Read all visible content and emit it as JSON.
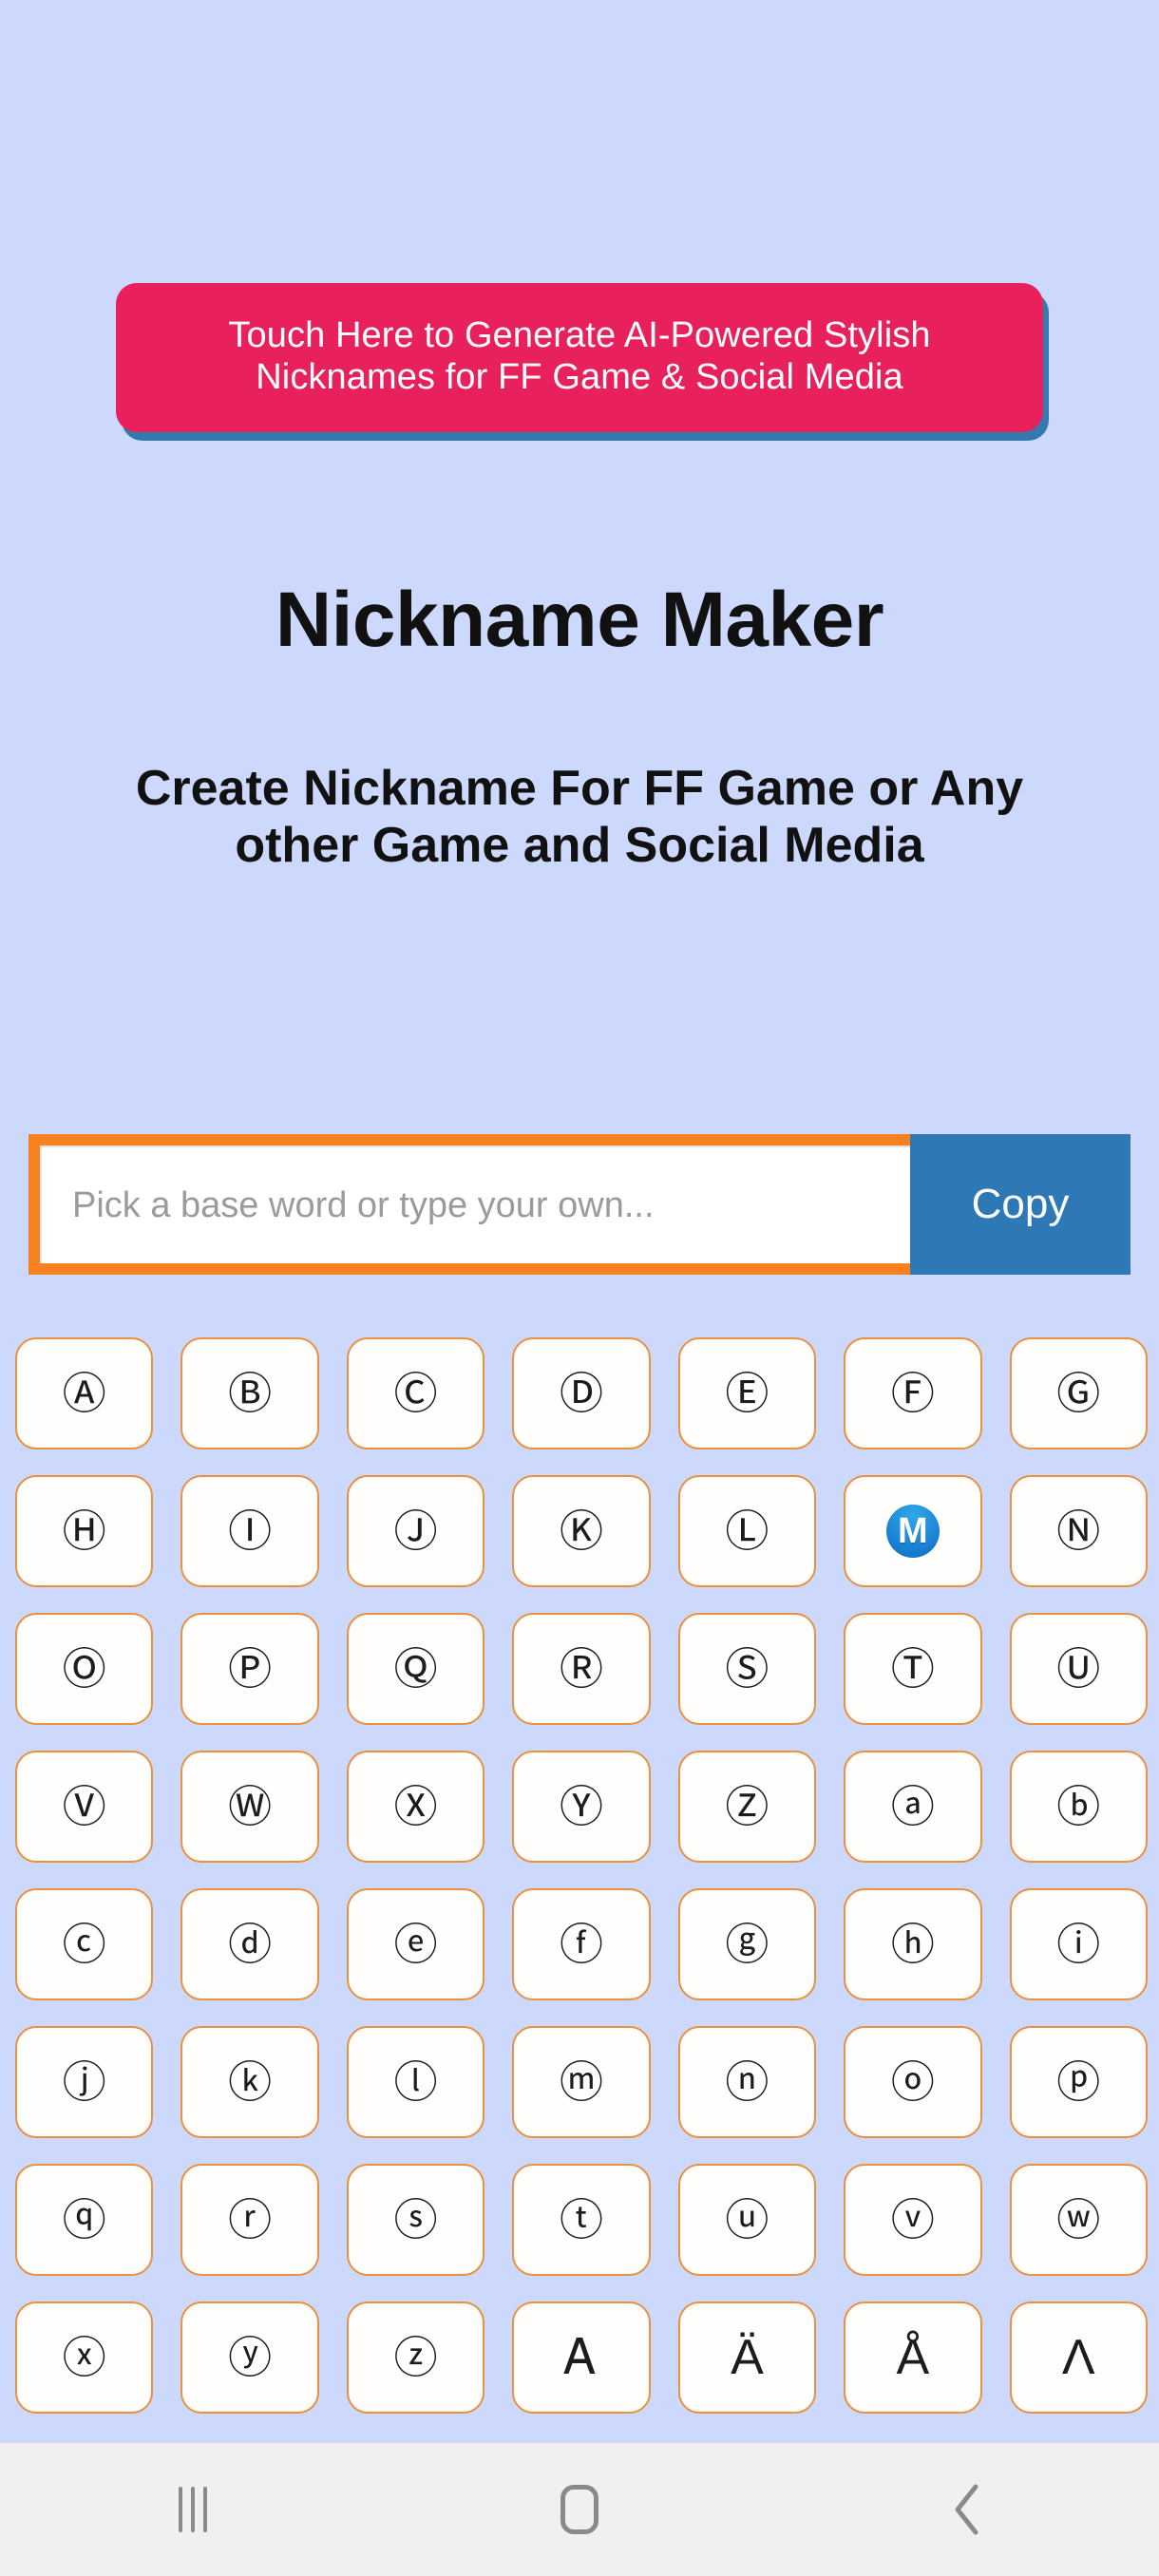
{
  "colors": {
    "background": "#ccd9fc",
    "banner_pink": "#e8215c",
    "banner_shadow_blue": "#3579ae",
    "accent_orange": "#f68121",
    "tile_border_orange": "#e8913f",
    "copy_blue": "#2e79b5",
    "selected_blue": "#1e86d6",
    "navbar_bg": "#f0f0f0"
  },
  "banner": {
    "label": "Touch Here to Generate AI-Powered Stylish Nicknames for FF Game & Social Media"
  },
  "header": {
    "title": "Nickname Maker",
    "subtitle": "Create Nickname For FF Game or Any other Game and Social Media"
  },
  "search": {
    "value": "",
    "placeholder": "Pick a base word or type your own...",
    "copy_label": "Copy"
  },
  "grid": {
    "columns": 7,
    "selected_index": 12,
    "tiles": [
      {
        "char": "Ⓐ",
        "label": "A",
        "style": "circled"
      },
      {
        "char": "Ⓑ",
        "label": "B",
        "style": "circled"
      },
      {
        "char": "Ⓒ",
        "label": "C",
        "style": "circled"
      },
      {
        "char": "Ⓓ",
        "label": "D",
        "style": "circled"
      },
      {
        "char": "Ⓔ",
        "label": "E",
        "style": "circled"
      },
      {
        "char": "Ⓕ",
        "label": "F",
        "style": "circled"
      },
      {
        "char": "Ⓖ",
        "label": "G",
        "style": "circled"
      },
      {
        "char": "Ⓗ",
        "label": "H",
        "style": "circled"
      },
      {
        "char": "Ⓘ",
        "label": "I",
        "style": "circled"
      },
      {
        "char": "Ⓙ",
        "label": "J",
        "style": "circled"
      },
      {
        "char": "Ⓚ",
        "label": "K",
        "style": "circled"
      },
      {
        "char": "Ⓛ",
        "label": "L",
        "style": "circled"
      },
      {
        "char": "M",
        "label": "M",
        "style": "emoji-blue-circle"
      },
      {
        "char": "Ⓝ",
        "label": "N",
        "style": "circled"
      },
      {
        "char": "Ⓞ",
        "label": "O",
        "style": "circled"
      },
      {
        "char": "Ⓟ",
        "label": "P",
        "style": "circled"
      },
      {
        "char": "Ⓠ",
        "label": "Q",
        "style": "circled"
      },
      {
        "char": "Ⓡ",
        "label": "R",
        "style": "circled"
      },
      {
        "char": "Ⓢ",
        "label": "S",
        "style": "circled"
      },
      {
        "char": "Ⓣ",
        "label": "T",
        "style": "circled"
      },
      {
        "char": "Ⓤ",
        "label": "U",
        "style": "circled"
      },
      {
        "char": "Ⓥ",
        "label": "V",
        "style": "circled"
      },
      {
        "char": "Ⓦ",
        "label": "W",
        "style": "circled"
      },
      {
        "char": "Ⓧ",
        "label": "X",
        "style": "circled"
      },
      {
        "char": "Ⓨ",
        "label": "Y",
        "style": "circled"
      },
      {
        "char": "Ⓩ",
        "label": "Z",
        "style": "circled"
      },
      {
        "char": "ⓐ",
        "label": "a",
        "style": "circled"
      },
      {
        "char": "ⓑ",
        "label": "b",
        "style": "circled"
      },
      {
        "char": "ⓒ",
        "label": "c",
        "style": "circled"
      },
      {
        "char": "ⓓ",
        "label": "d",
        "style": "circled"
      },
      {
        "char": "ⓔ",
        "label": "e",
        "style": "circled"
      },
      {
        "char": "ⓕ",
        "label": "f",
        "style": "circled"
      },
      {
        "char": "ⓖ",
        "label": "g",
        "style": "circled"
      },
      {
        "char": "ⓗ",
        "label": "h",
        "style": "circled"
      },
      {
        "char": "ⓘ",
        "label": "i",
        "style": "circled"
      },
      {
        "char": "ⓙ",
        "label": "j",
        "style": "circled"
      },
      {
        "char": "ⓚ",
        "label": "k",
        "style": "circled"
      },
      {
        "char": "ⓛ",
        "label": "l",
        "style": "circled"
      },
      {
        "char": "ⓜ",
        "label": "m",
        "style": "circled"
      },
      {
        "char": "ⓝ",
        "label": "n",
        "style": "circled"
      },
      {
        "char": "ⓞ",
        "label": "o",
        "style": "circled"
      },
      {
        "char": "ⓟ",
        "label": "p",
        "style": "circled"
      },
      {
        "char": "ⓠ",
        "label": "q",
        "style": "circled"
      },
      {
        "char": "ⓡ",
        "label": "r",
        "style": "circled"
      },
      {
        "char": "ⓢ",
        "label": "s",
        "style": "circled"
      },
      {
        "char": "ⓣ",
        "label": "t",
        "style": "circled"
      },
      {
        "char": "ⓤ",
        "label": "u",
        "style": "circled"
      },
      {
        "char": "ⓥ",
        "label": "v",
        "style": "circled"
      },
      {
        "char": "ⓦ",
        "label": "w",
        "style": "circled"
      },
      {
        "char": "ⓧ",
        "label": "x",
        "style": "circled"
      },
      {
        "char": "ⓨ",
        "label": "y",
        "style": "circled"
      },
      {
        "char": "ⓩ",
        "label": "z",
        "style": "circled"
      },
      {
        "char": "Ꭺ",
        "label": "A rounded",
        "style": "plain"
      },
      {
        "char": "Ä",
        "label": "A umlaut",
        "style": "plain"
      },
      {
        "char": "Å",
        "label": "A ring",
        "style": "plain"
      },
      {
        "char": "Λ",
        "label": "Lambda",
        "style": "plain"
      }
    ]
  },
  "navbar": {
    "recents_label": "Recent apps",
    "home_label": "Home",
    "back_label": "Back"
  }
}
